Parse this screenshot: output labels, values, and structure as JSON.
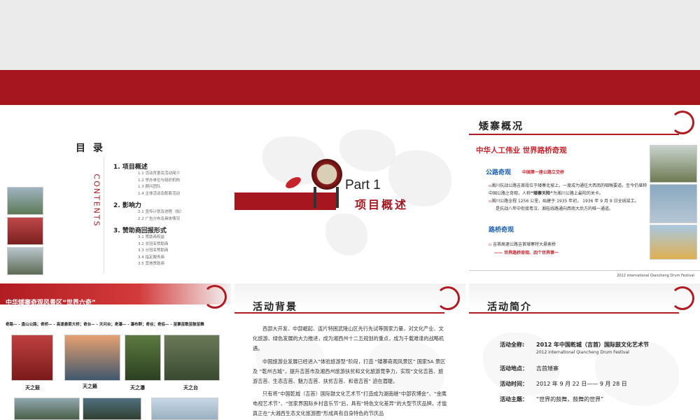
{
  "slide1": {
    "title": "目 录",
    "contents_vertical": "CONTENTS",
    "sections": [
      {
        "heading": "1. 项目概述",
        "items": [
          "1.1  活动背景及活动简介",
          "1.2  举办单位与组织机构",
          "1.3  顾问团队",
          "1.4  主体活动及配套活动"
        ]
      },
      {
        "heading": "2. 影响力",
        "items": [
          "2.1  宣传计划及进程（拟）",
          "2.2  广告分布及具体情况"
        ]
      },
      {
        "heading": "3. 赞助商回报形式",
        "items": [
          "3.1  赞助商权益",
          "3.2  总冠名赞助商",
          "3.3  分冠名赞助商",
          "3.4  指定服务商",
          "3.5  其他赞助商"
        ]
      }
    ]
  },
  "slide2": {
    "part": "Part 1",
    "title": "项目概述"
  },
  "slide3": {
    "header": "矮寨概况",
    "subtitle": "中华人工伟业  世界路桥奇观",
    "road_title": "公路奇观",
    "road_sub": "中国第一座公路立交桥",
    "road_p1": "湘川抗战公路吉首段位于矮寨北坡上，一度成为通往大西南的咽喉要道。至今仍堪称中国公路之奇观，人称",
    "road_p1_bold": "“矮寨天险”",
    "road_p1_end": "为湘川公路上最险的关卡。",
    "road_p2": "湘川公路全程 1256 公里，始建于 1935 年初， 1936 年 9 月 9 日全线竣工。",
    "road_p3": "是抗战八年中衔接粤汉、湘桂线路通向西南大后方的唯一通道。",
    "bridge_title": "路桥奇观",
    "bridge_p1": "吉茶高速公路吉首矮寨特大悬索桥",
    "bridge_p2": "—— 世界路桥奇观、四个世界第一",
    "footer": "2012 international Qiancheng Drum Festival"
  },
  "slide4": {
    "header": "中华矮寨奇观风景区“世界六奇”",
    "list": "奇路— - 盘山公路；奇桥— - 高速悬索大桥；奇台— - 天问台；奇瀑— - 瀑布群；奇谷；奇俗— - 苗寨苗歌苗鼓苗舞",
    "captions": [
      "天之鼓",
      "天之籁",
      "天之瀑",
      "天之台"
    ]
  },
  "slide5": {
    "header": "活动背景",
    "p1": "西部大开发、中部崛起、连片特困武陵山区先行先试等国家力量，对文化产业、文化旅游、绿色发展的大力推进，成为湘西州十二五规划的重点，成为千载难逢的战略机遇。",
    "p2": "中国旅游业发展已经进入“体验旅游型”阶段，打造 “矮寨奇观风景区” 国家5A 景区及 “乾州古城”，提升吉首市及湘西州旅游扶贫和文化旅游竞争力，实现“文化吉首、旅游吉首、生态吉首、魅力吉首、扶贫吉首、和谐吉首” 迫在眉睫。",
    "p3": "只有将“中国乾城（吉首）国际鼓文化艺术节”打造成为湖南继“中部农博会”、“金鹰电视艺术节”、“张家界国际乡村音乐节”后，具有“特色文化差异”的大型节庆品牌，才能真正在“大湘西生态文化旅游圈”形成具有自身特色的节庆品"
  },
  "slide6": {
    "header": "活动简介",
    "rows": [
      {
        "label": "活动全称:",
        "value": "2012 年中国乾城（吉首）国际鼓文化艺术节",
        "sub": "2012 international Qiancheng Drum Festival"
      },
      {
        "label": "活动地点：",
        "value": "吉首矮寨",
        "sub": ""
      },
      {
        "label": "活动时间：",
        "value": "2012 年 9 月 22 日—— 9 月 28 日",
        "sub": ""
      },
      {
        "label": "活动主题：",
        "value": "“世界的鼓舞，鼓舞的世界”",
        "sub": ""
      }
    ]
  },
  "colors": {
    "brand_red": "#a5161e",
    "accent_red": "#c8232c",
    "blue": "#1a5fb4"
  }
}
